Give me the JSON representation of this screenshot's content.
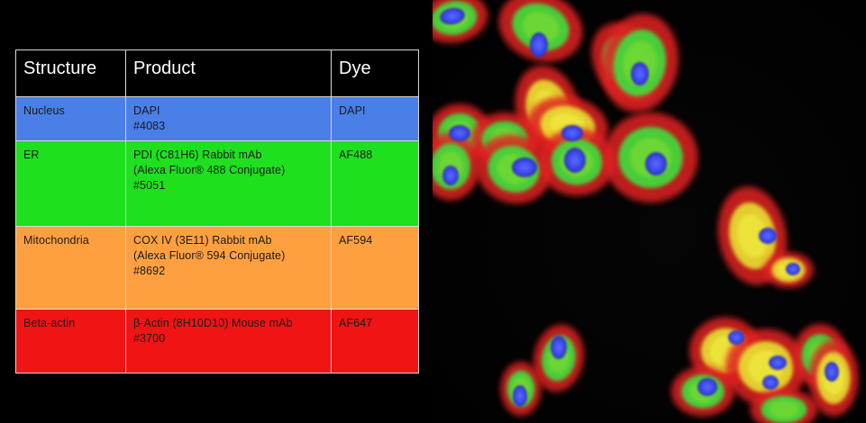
{
  "table": {
    "headers": [
      "Structure",
      "Product",
      "Dye"
    ],
    "rows": [
      {
        "structure": "Nucleus",
        "product_lines": [
          "DAPI",
          "#4083"
        ],
        "dye": "DAPI",
        "color": "#4a7fe8"
      },
      {
        "structure": "ER",
        "product_lines": [
          "PDI (C81H6) Rabbit mAb",
          "(Alexa Fluor® 488 Conjugate)",
          "#5051"
        ],
        "dye": "AF488",
        "color": "#1fe01f"
      },
      {
        "structure": "Mitochondria",
        "product_lines": [
          "COX IV (3E11) Rabbit mAb",
          "(Alexa Fluor® 594 Conjugate)",
          "#8692"
        ],
        "dye": "AF594",
        "color": "#ffa040"
      },
      {
        "structure": "Beta-actin",
        "product_lines": [
          "β-Actin (8H10D10) Mouse mAb",
          "#3700"
        ],
        "dye": "AF647",
        "color": "#f01414"
      }
    ]
  },
  "image": {
    "subject": "fluorescence-microscopy-cells",
    "colors": {
      "nucleus": "#3a4cff",
      "er": "#3ce03c",
      "mito": "#e8e030",
      "actin": "#e02020"
    }
  }
}
